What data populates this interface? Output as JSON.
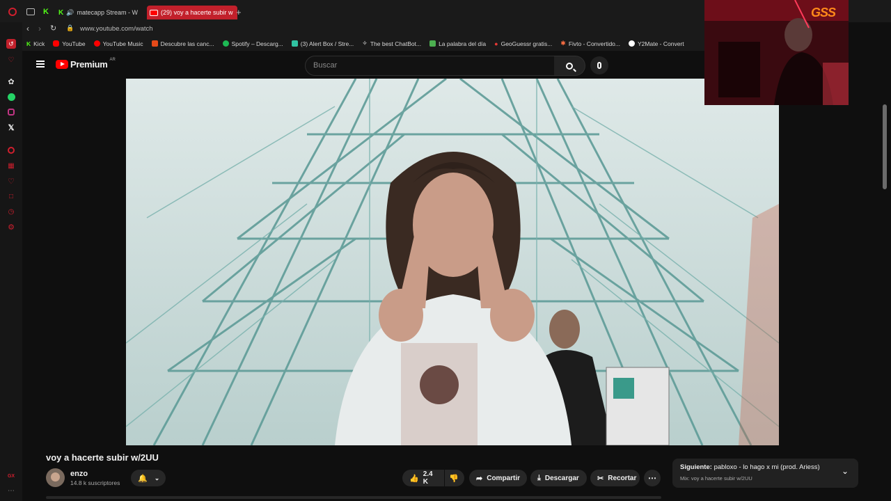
{
  "browser": {
    "tabs": [
      {
        "label": "matecapp Stream - W",
        "icon": "kick-icon",
        "audio": true
      },
      {
        "label": "(29) voy a hacerte subir w",
        "icon": "youtube-icon",
        "active": true
      }
    ],
    "address": "www.youtube.com/watch",
    "bookmarks": [
      {
        "label": "Kick",
        "icon": "kick-icon",
        "color": "#53fc18"
      },
      {
        "label": "YouTube",
        "icon": "youtube-icon",
        "color": "#ff0000"
      },
      {
        "label": "YouTube Music",
        "icon": "youtube-music-icon",
        "color": "#ff0000"
      },
      {
        "label": "Descubre las canc...",
        "icon": "music-note-icon",
        "color": "#e64a19"
      },
      {
        "label": "Spotify – Descarg...",
        "icon": "spotify-icon",
        "color": "#1db954"
      },
      {
        "label": "(3) Alert Box / Stre...",
        "icon": "alert-box-icon",
        "color": "#31c3a2"
      },
      {
        "label": "The best ChatBot...",
        "icon": "chatbot-icon",
        "color": "#ffffff"
      },
      {
        "label": "La palabra del día",
        "icon": "p-icon",
        "color": "#4caf50"
      },
      {
        "label": "GeoGuessr gratis...",
        "icon": "map-pin-icon",
        "color": "#e53935"
      },
      {
        "label": "Fivto - Convertido...",
        "icon": "convert-icon",
        "color": "#ff7043"
      },
      {
        "label": "Y2Mate - Convert",
        "icon": "y2mate-icon",
        "color": "#ffffff"
      }
    ]
  },
  "youtube": {
    "logo_text": "Premium",
    "country": "AR",
    "search_placeholder": "Buscar",
    "video_title": "voy a hacerte subir w/2UU",
    "channel": {
      "name": "enzo",
      "subscribers": "14.8 k suscriptores"
    },
    "actions": {
      "likes": "2.4 K",
      "share": "Compartir",
      "download": "Descargar",
      "clip": "Recortar"
    },
    "up_next": {
      "prefix": "Siguiente:",
      "title": "pabloxo - lo hago x mi (prod. Ariess)",
      "playlist": "Mix: voy a hacerte subir w/2UU"
    }
  },
  "overlay": {
    "webcam_logo": "GSS"
  },
  "colors": {
    "accent": "#ff0000",
    "browser_accent": "#c2202b",
    "bg": "#0f0f0f"
  }
}
